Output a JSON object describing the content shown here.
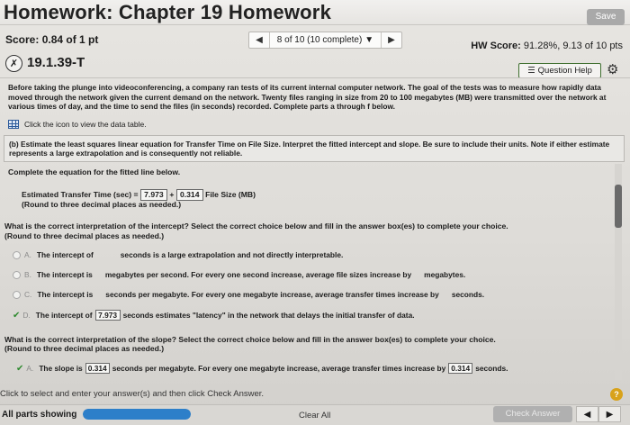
{
  "header": {
    "title": "Homework: Chapter 19 Homework",
    "save_label": "Save"
  },
  "score_bar": {
    "score_label": "Score:",
    "score_value": "0.84 of 1 pt",
    "nav_text": "8 of 10 (10 complete)",
    "hw_score_label": "HW Score:",
    "hw_score_value": "91.28%, 9.13 of 10 pts"
  },
  "question": {
    "id": "19.1.39-T",
    "help_label": "Question Help",
    "intro": "Before taking the plunge into videoconferencing, a company ran tests of its current internal computer network. The goal of the tests was to measure how rapidly data moved through the network given the current demand on the network. Twenty files ranging in size from 20 to 100 megabytes (MB) were transmitted over the network at various times of day, and the time to send the files (in seconds) recorded. Complete parts a through f below.",
    "data_link": "Click the icon to view the data table.",
    "part_text": "(b) Estimate the least squares linear equation for Transfer Time on File Size. Interpret the fitted intercept and slope. Be sure to include their units. Note if either estimate represents a large extrapolation and is consequently not reliable.",
    "complete_eq": "Complete the equation for the fitted line below.",
    "eq_lhs": "Estimated Transfer Time (sec) =",
    "eq_intercept": "7.973",
    "eq_plus": "+",
    "eq_slope": "0.314",
    "eq_rhs": "File Size (MB)",
    "eq_round": "(Round to three decimal places as needed.)",
    "intercept_q": "What is the correct interpretation of the intercept? Select the correct choice below and fill in the answer box(es) to complete your choice.",
    "intercept_round": "(Round to three decimal places as needed.)",
    "options": [
      {
        "letter": "A.",
        "pre": "The intercept of",
        "post": "seconds is a large extrapolation and not directly interpretable."
      },
      {
        "letter": "B.",
        "pre": "The intercept is",
        "mid": "megabytes per second. For every one second increase, average file sizes increase by",
        "post": "megabytes."
      },
      {
        "letter": "C.",
        "pre": "The intercept is",
        "mid": "seconds per megabyte. For every one megabyte increase, average transfer times increase by",
        "post": "seconds."
      },
      {
        "letter": "D.",
        "pre": "The intercept of",
        "value": "7.973",
        "post": "seconds estimates \"latency\" in the network that delays the initial transfer of data."
      }
    ],
    "slope_q": "What is the correct interpretation of the slope? Select the correct choice below and fill in the answer box(es) to complete your choice.",
    "slope_round": "(Round to three decimal places as needed.)",
    "slope_option": {
      "letter": "A.",
      "pre": "The slope is",
      "value1": "0.314",
      "mid": "seconds per megabyte. For every one megabyte increase, average transfer times increase by",
      "value2": "0.314",
      "post": "seconds."
    }
  },
  "footer": {
    "instruction": "Click to select and enter your answer(s) and then click Check Answer.",
    "help_symbol": "?",
    "all_parts": "All parts showing",
    "progress_fraction": 1.0,
    "clear_all": "Clear All",
    "check_answer": "Check Answer"
  },
  "colors": {
    "accent_blue": "#2d7fc9",
    "correct_green": "#2f8a2f",
    "help_yellow": "#d8a21a"
  }
}
